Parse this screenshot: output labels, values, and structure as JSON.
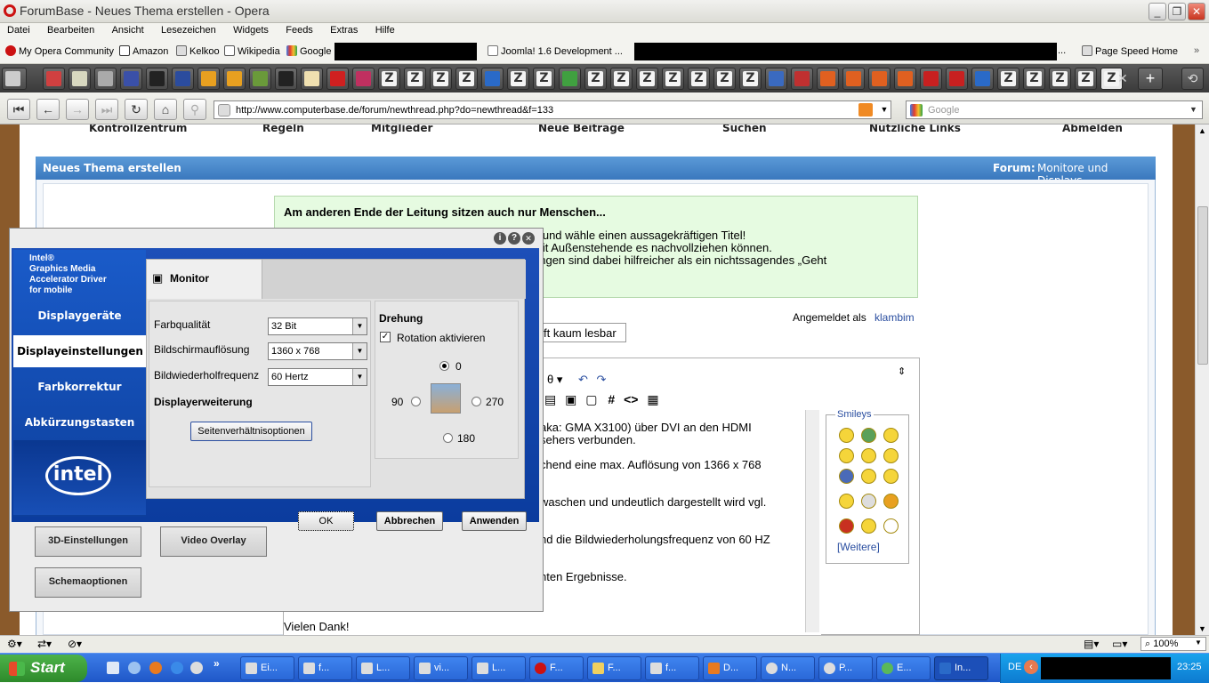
{
  "window": {
    "title": "ForumBase - Neues Thema erstellen - Opera"
  },
  "menu": [
    "Datei",
    "Bearbeiten",
    "Ansicht",
    "Lesezeichen",
    "Widgets",
    "Feeds",
    "Extras",
    "Hilfe"
  ],
  "bookmarks": {
    "b1": "My Opera Community",
    "b2": "Amazon",
    "b3": "Kelkoo",
    "b4": "Wikipedia",
    "b5": "Google",
    "b6": "Joomla! 1.6 Development ...",
    "b7": "...",
    "b8": "Page Speed Home"
  },
  "address": {
    "url": "http://www.computerbase.de/forum/newthread.php?do=newthread&f=133",
    "search_placeholder": "Google"
  },
  "forum": {
    "nav": [
      "Kontrollzentrum",
      "Regeln",
      "Mitglieder",
      "Neue Beiträge",
      "Suchen",
      "Nützliche Links",
      "Abmelden"
    ],
    "header_title": "Neues Thema erstellen",
    "header_forum_label": "Forum:",
    "header_forum_value": "Monitore und Displays",
    "info_title": "Am anderen Ende der Leitung sitzen auch nur Menschen...",
    "info_line1": "n und wähle einen aussagekräftigen Titel!",
    "info_line2": "mit Außenstehende es nachvollziehen können.",
    "info_line3": "ungen sind dabei hilfreicher als ein nichtssagendes „Geht",
    "logged_in_label": "Angemeldet als",
    "logged_in_user": "klambim",
    "title_field": "ft kaum lesbar",
    "body_line1": "aka: GMA X3100) über DVI an den HDMI",
    "body_line2": "sehers verbunden.",
    "body_line3": "chend eine max. Auflösung von 1366 x 768",
    "body_line4": "waschen und undeutlich dargestellt wird vgl.",
    "body_line5": "nd die Bildwiederholungsfrequenz von 60 HZ",
    "body_line6": "nten Ergebnisse.",
    "body_line7": "Vielen Dank!",
    "smileys_label": "Smileys",
    "smileys_more": "[Weitere]"
  },
  "intel": {
    "brand_line1": "Intel®",
    "brand_line2": "Graphics Media",
    "brand_line3": "Accelerator Driver",
    "brand_line4": "for mobile",
    "logo_text": "intel",
    "nav": [
      "Displaygeräte",
      "Displayeinstellungen",
      "Farbkorrektur",
      "Abkürzungstasten"
    ],
    "tab": "Monitor",
    "farbqualitaet_label": "Farbqualität",
    "farbqualitaet_value": "32 Bit",
    "aufloesung_label": "Bildschirmauflösung",
    "aufloesung_value": "1360 x 768",
    "frequenz_label": "Bildwiederholfrequenz",
    "frequenz_value": "60 Hertz",
    "erweiterung_label": "Displayerweiterung",
    "seitenverhaeltnis_button": "Seitenverhältnisoptionen",
    "drehung_label": "Drehung",
    "rotation_checkbox": "Rotation aktivieren",
    "rot_0": "0",
    "rot_90": "90",
    "rot_270": "270",
    "rot_180": "180",
    "ok": "OK",
    "abbrechen": "Abbrechen",
    "anwenden": "Anwenden",
    "btn_3d": "3D-Einstellungen",
    "btn_video": "Video Overlay",
    "btn_schema": "Schemaoptionen"
  },
  "status": {
    "zoom": "100%"
  },
  "taskbar": {
    "start": "Start",
    "tasks": [
      "Ei...",
      "f...",
      "L...",
      "vi...",
      "L...",
      "F...",
      "F...",
      "f...",
      "D...",
      "N...",
      "P...",
      "E...",
      "In..."
    ],
    "lang": "DE",
    "clock": "23:25"
  }
}
